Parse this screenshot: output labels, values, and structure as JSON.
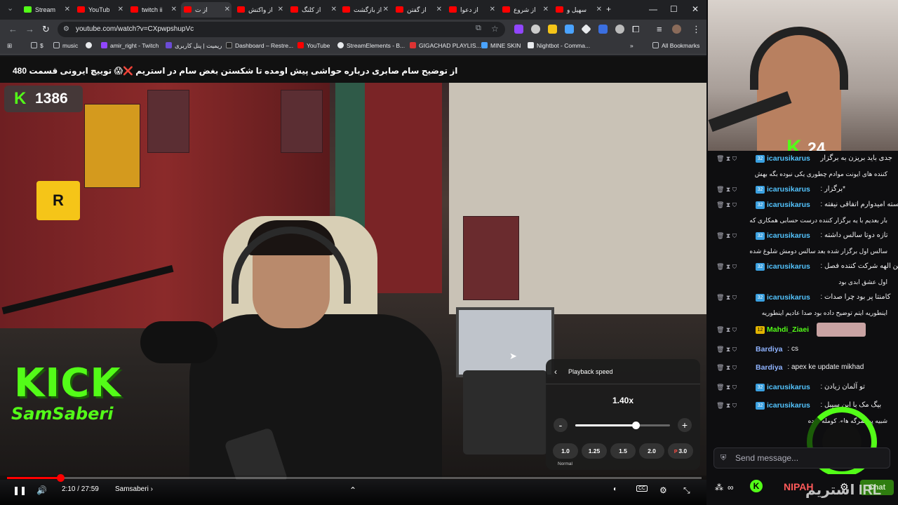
{
  "browser": {
    "tabs": [
      {
        "label": "Stream",
        "icon": "kick-icon"
      },
      {
        "label": "YouTub",
        "icon": "youtube-icon"
      },
      {
        "label": "twitch ii",
        "icon": "youtube-icon"
      },
      {
        "label": "از ت",
        "icon": "youtube-icon"
      },
      {
        "label": "از واکنش",
        "icon": "youtube-icon"
      },
      {
        "label": "از کلنگ",
        "icon": "youtube-icon"
      },
      {
        "label": "از بازگشت",
        "icon": "youtube-icon"
      },
      {
        "label": "از گفتن",
        "icon": "youtube-icon"
      },
      {
        "label": "از دعوا",
        "icon": "youtube-icon"
      },
      {
        "label": "از شروع",
        "icon": "youtube-icon"
      },
      {
        "label": "سهیل و",
        "icon": "youtube-icon"
      }
    ],
    "url": "youtube.com/watch?v=CXpwpshupVc",
    "bookmarks": [
      "$",
      "music",
      "amir_right - Twitch",
      "ریمیت | پنل کاربری",
      "Dashboard – Restre...",
      "YouTube",
      "StreamElements - B...",
      "GIGACHAD PLAYLIS...",
      "MINE SKIN",
      "Nightbot - Comma..."
    ],
    "all_bookmarks": "All Bookmarks",
    "new_tab": "+",
    "minimize": "—",
    "maximize": "☐",
    "close": "✕"
  },
  "video": {
    "title": "از توضیح سام صابری درباره حواشی پیش اومده تا شکستن بغض سام در استریم ❌😱 توییچ ایرونی قسمت 480",
    "kick_counter": {
      "k": "K",
      "value": "1386"
    },
    "overlay_kick": "KICK",
    "overlay_name": "SamSaberi",
    "sign_r": "R",
    "playback_speed": {
      "header": "Playback speed",
      "current": "1.40x",
      "level_percent": 64,
      "presets": [
        "1.0",
        "1.25",
        "1.5",
        "2.0",
        "3.0"
      ],
      "normal_label": "Normal",
      "minus": "-",
      "plus": "+"
    },
    "player": {
      "time": "2:10 / 27:59",
      "channel": "Samsaberi",
      "progress_percent": 7.7
    }
  },
  "stream": {
    "viewers_k": "K",
    "viewers": "24"
  },
  "chat": {
    "messages": [
      {
        "user": "icarusikarus",
        "color": "#53c4ff",
        "badge": "32",
        "line1": "جدی باید بریزن به برگزار",
        "line2": "کننده های ایونت موادم چطوری یکی نبوده بگه بهش"
      },
      {
        "user": "icarusikarus",
        "color": "#53c4ff",
        "badge": "32",
        "line1": ": برگزار*",
        "line2": ""
      },
      {
        "user": "icarusikarus",
        "color": "#53c4ff",
        "badge": "32",
        "line1": ": درسته امیدوارم اتفاقی نیفته",
        "line2": "بار بعدیم با یه برگزار کننده درست حسابی همکاری که"
      },
      {
        "user": "icarusikarus",
        "color": "#53c4ff",
        "badge": "32",
        "line1": ": تازه دوتا سالس داشته",
        "line2": "سالس اول برگزار شده بعد سالس دومش شلوغ شده"
      },
      {
        "user": "icarusikarus",
        "color": "#53c4ff",
        "badge": "32",
        "line1": ": این الهه شرکت کننده فصل",
        "line2": "اول عشق ابدی بود"
      },
      {
        "user": "icarusikarus",
        "color": "#53c4ff",
        "badge": "32",
        "line1": ": کامنتا پر بود چرا صدات",
        "line2": "اینطوریه ایتم توضیح داده بود صدا عادیم اینطوریه"
      },
      {
        "user": "Mahdi_Ziaei",
        "color": "#53fc18",
        "badge": "12",
        "line1": ":",
        "line2": ""
      },
      {
        "user": "Bardiya",
        "color": "#8fb3ff",
        "badge": "",
        "line1": ": cs",
        "line2": ""
      },
      {
        "user": "Bardiya",
        "color": "#8fb3ff",
        "badge": "",
        "line1": ": apex ke update mikhad",
        "line2": ""
      },
      {
        "user": "icarusikarus",
        "color": "#53c4ff",
        "badge": "32",
        "line1": ": تو آلمان زیادن",
        "line2": ""
      },
      {
        "user": "icarusikarus",
        "color": "#53c4ff",
        "badge": "32",
        "line1": ": بیگ مک با این سیبل",
        "line2": "شبیه پیشمرگه های کومله شده"
      }
    ],
    "input_placeholder": "Send message...",
    "send_label": "Chat",
    "overlay_text": "استریم IRL",
    "footer_brand": "NIPAH"
  },
  "colors": {
    "kick_green": "#53fc18",
    "yt_red": "#ff0000",
    "chat_bg": "#0e0e10",
    "browser_dark": "#202124"
  }
}
